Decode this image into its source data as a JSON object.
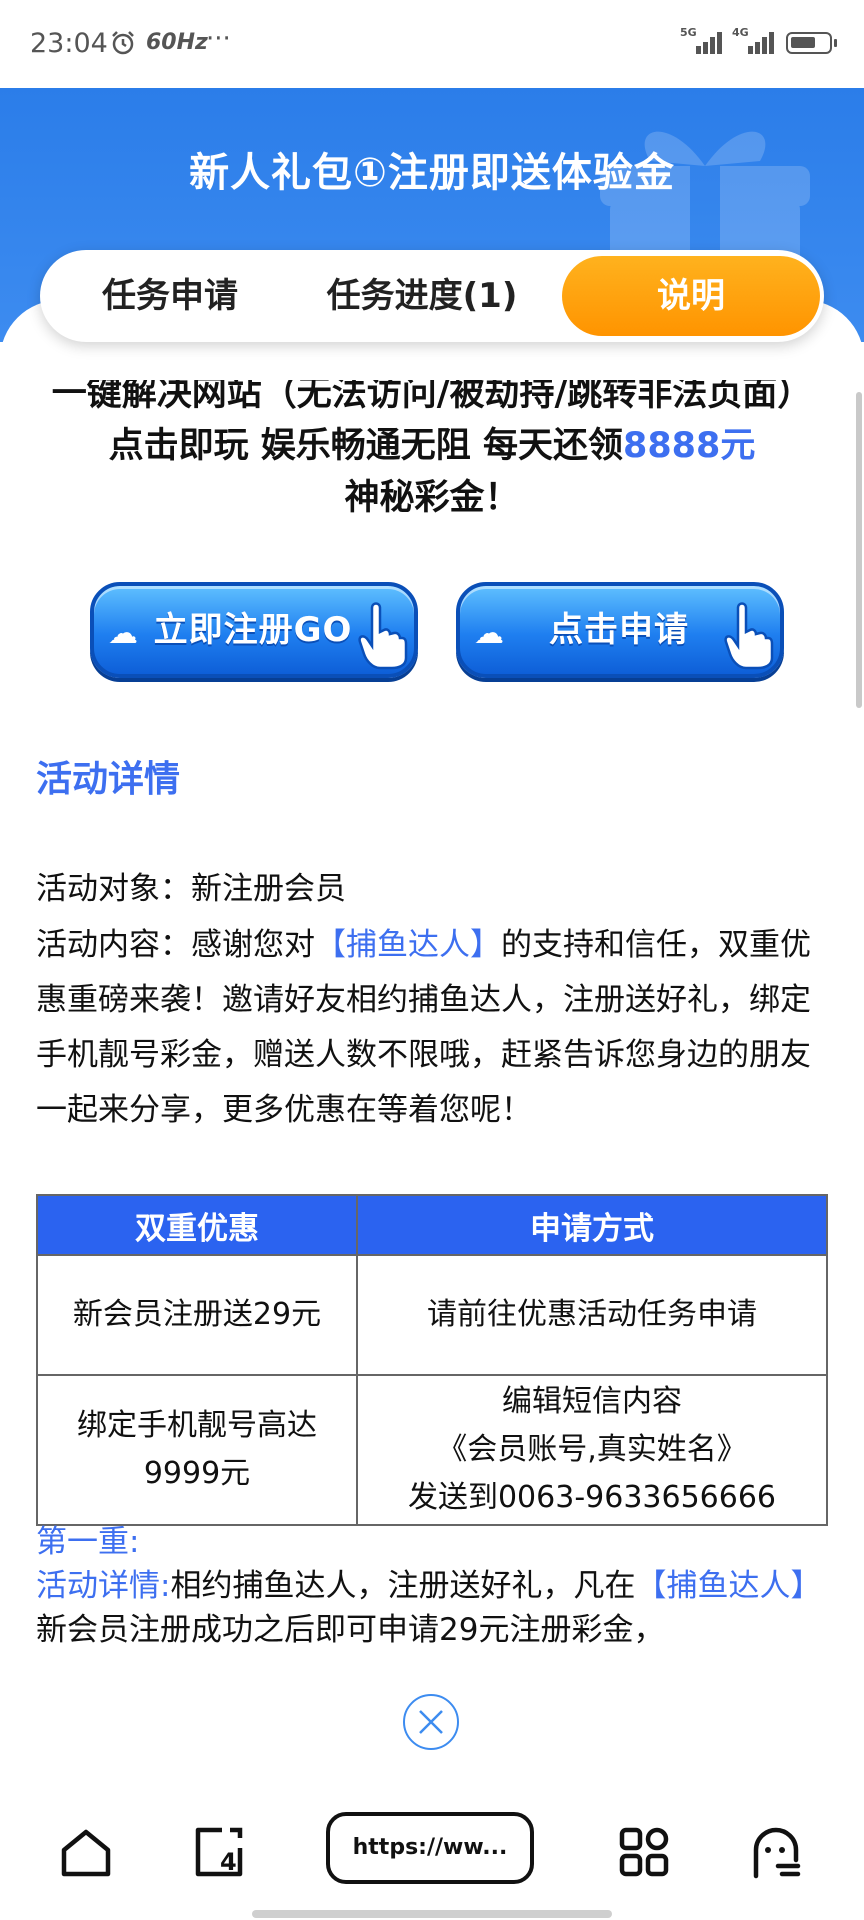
{
  "status_bar": {
    "time": "23:04",
    "alarm_icon": "alarm-icon",
    "refresh_rate": "60Hz",
    "more": "···",
    "sim1": "5G",
    "sim2": "4G"
  },
  "header": {
    "title": "新人礼包①注册即送体验金"
  },
  "tabs": [
    {
      "label": "任务申请"
    },
    {
      "label": "任务进度(1)"
    },
    {
      "label": "说明",
      "active": true
    }
  ],
  "intro": {
    "text": "一键解决网站（无法访问/被劫持/跳转非法页面） 点击即玩 娱乐畅通无阻 每天还领",
    "amount": "8888元",
    "text_end": "神秘彩金！"
  },
  "buttons": {
    "register": "立即注册GO",
    "apply": "点击申请"
  },
  "activity": {
    "section_title": "活动详情",
    "target_label": "活动对象：",
    "target_value": "新注册会员",
    "content_label": "活动内容：",
    "content_pre": "感谢您对",
    "content_brand": "【捕鱼达人】",
    "content_post": "的支持和信任，双重优惠重磅来袭！邀请好友相约捕鱼达人，注册送好礼，绑定手机靓号彩金，赠送人数不限哦，赶紧告诉您身边的朋友一起来分享，更多优惠在等着您呢！"
  },
  "table": {
    "headers": [
      "双重优惠",
      "申请方式"
    ],
    "row1": {
      "offer": "新会员注册送29元",
      "method": "请前往优惠活动任务申请"
    },
    "row2": {
      "offer_line1": "绑定手机靓号高达",
      "offer_line2": "9999元",
      "method_line1": "编辑短信内容",
      "method_line2": "《会员账号,真实姓名》",
      "method_line3": "发送到0063-9633656666"
    }
  },
  "first_tier": {
    "title": "第一重:",
    "detail_label": "活动详情:",
    "detail_pre": "相约捕鱼达人，注册送好礼，凡在",
    "detail_brand": "【捕鱼达人】",
    "detail_post": "新会员注册成功之后即可申请29元注册彩金，"
  },
  "bottom_nav": {
    "url": "https://ww..."
  },
  "colors": {
    "header_blue": "#2b7de9",
    "accent_blue": "#3d6ff0",
    "tab_orange": "#ff9d0a",
    "table_header": "#2b63f0"
  }
}
